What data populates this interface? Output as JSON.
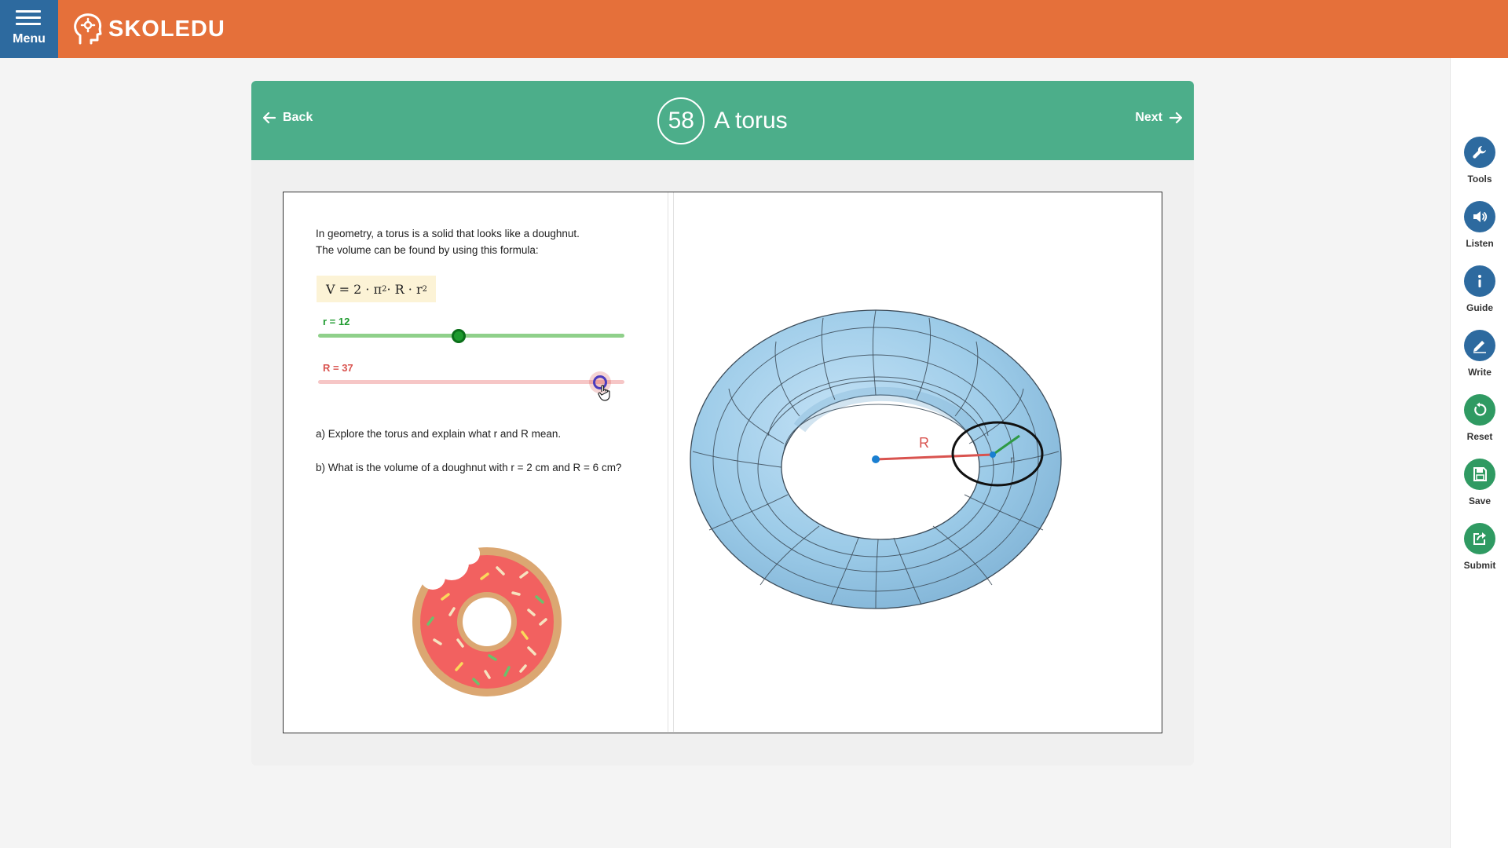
{
  "header": {
    "menu_label": "Menu",
    "logo_text": "SKOLEDU"
  },
  "lesson": {
    "back_label": "Back",
    "next_label": "Next",
    "number": "58",
    "title": "A torus"
  },
  "content": {
    "intro_line1": "In geometry, a torus is a solid that looks like a doughnut.",
    "intro_line2": "The volume can be found by using this formula:",
    "formula": {
      "v": "V = 2 · π",
      "mid": " · R · r",
      "exp": "2"
    },
    "slider_r": {
      "label": "r = 12",
      "value": 12,
      "position_fraction": 0.46,
      "color": "#1e9a2e",
      "track_color": "#8fd08a"
    },
    "slider_R": {
      "label": "R = 37",
      "value": 37,
      "position_fraction": 0.92,
      "color": "#d9534f",
      "track_color": "#f6c6c6"
    },
    "question_a": "a) Explore the torus and explain what r and R mean.",
    "question_b": "b) What is the volume of a doughnut with r = 2 cm and R = 6 cm?",
    "torus_labels": {
      "major": "R",
      "minor": "r"
    }
  },
  "sidebar": {
    "tools": "Tools",
    "listen": "Listen",
    "guide": "Guide",
    "write": "Write",
    "reset": "Reset",
    "save": "Save",
    "submit": "Submit"
  },
  "colors": {
    "topbar": "#e5703a",
    "menu": "#2d6a9f",
    "card_header": "#4cae8a",
    "torus": "#9ccbe8"
  }
}
